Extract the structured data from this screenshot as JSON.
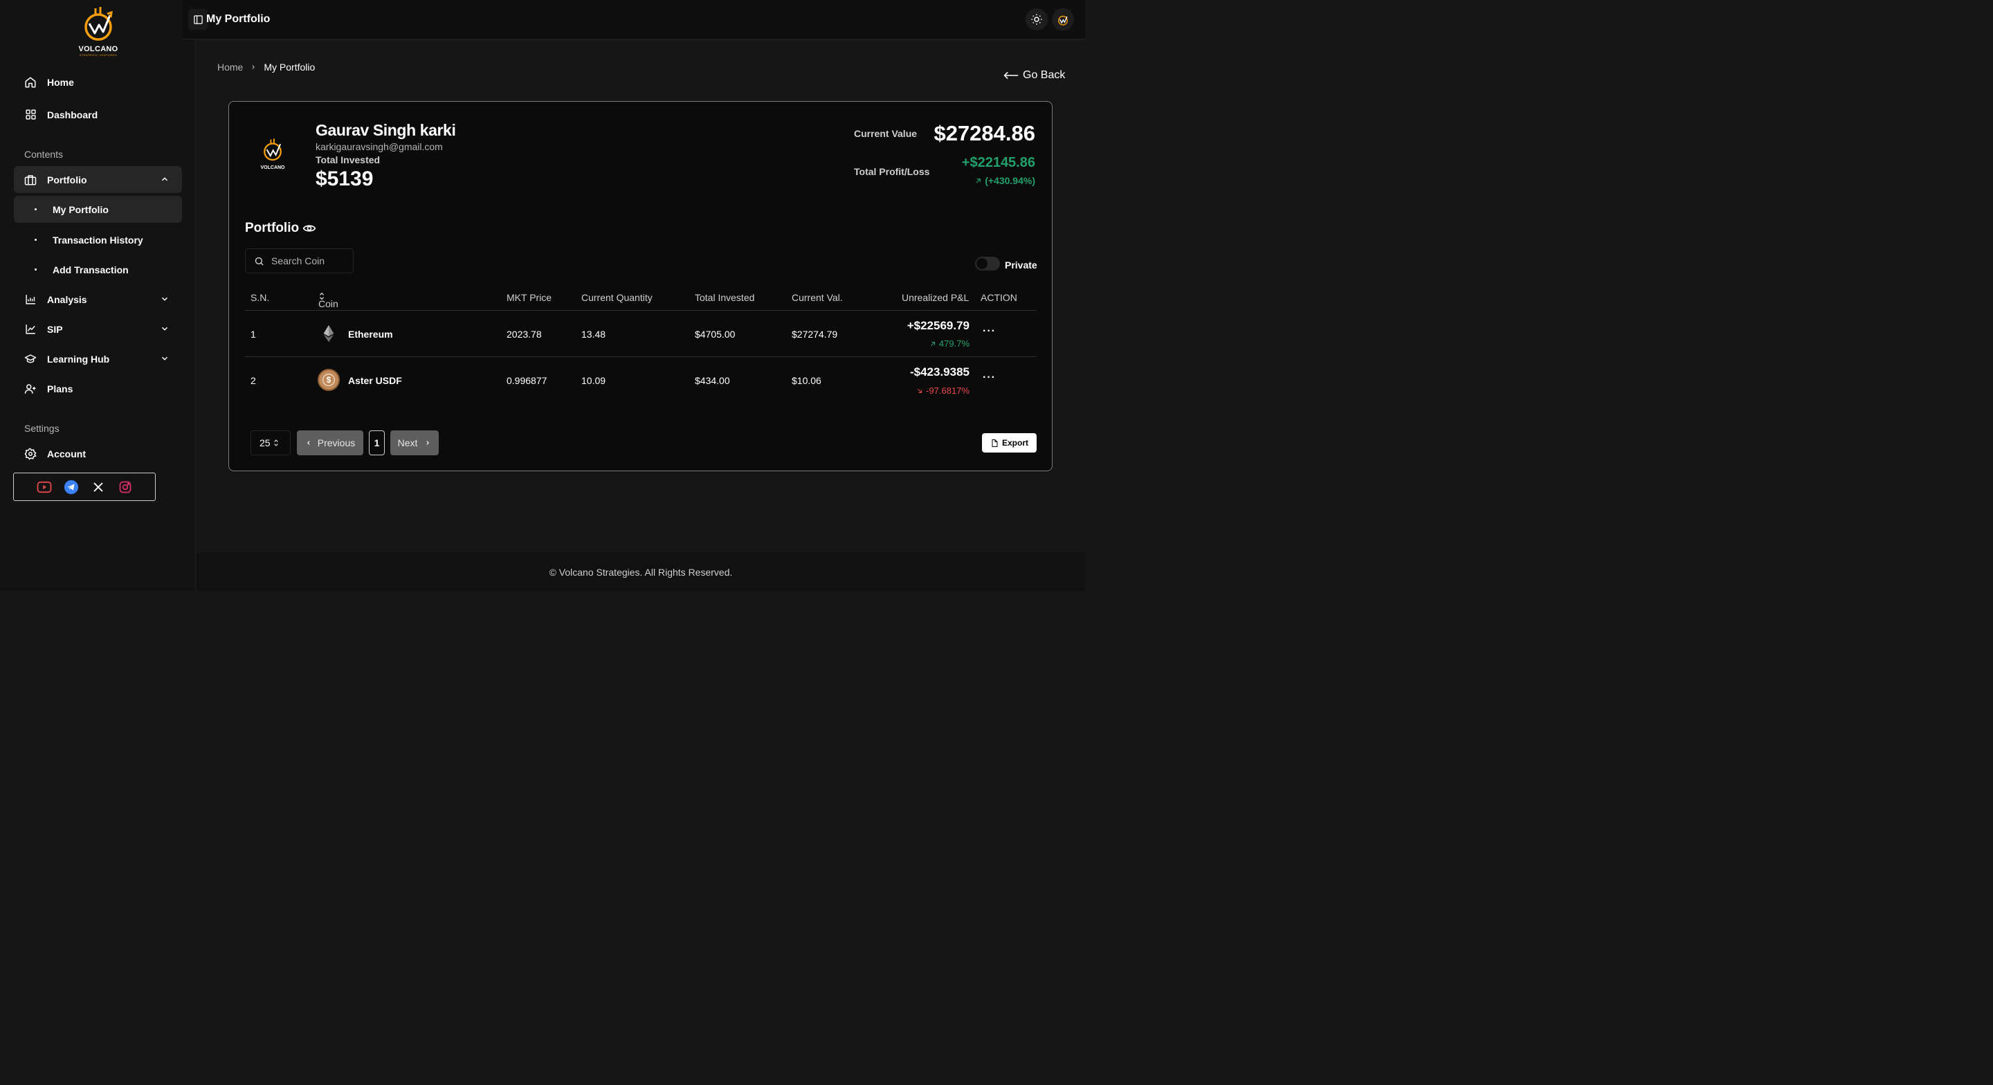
{
  "brand": {
    "name": "VOLCANO",
    "tagline": "STRATEGIC VENTURES",
    "accent": "#f59e0b"
  },
  "sidebar": {
    "main_items": [
      {
        "label": "Home",
        "icon": "home-icon"
      },
      {
        "label": "Dashboard",
        "icon": "grid-icon"
      }
    ],
    "contents_label": "Contents",
    "portfolio": {
      "label": "Portfolio",
      "icon": "briefcase-icon",
      "expanded": true,
      "children": [
        "My Portfolio",
        "Transaction History",
        "Add Transaction"
      ]
    },
    "groups": [
      {
        "label": "Analysis",
        "icon": "bar-chart-icon"
      },
      {
        "label": "SIP",
        "icon": "line-chart-icon"
      },
      {
        "label": "Learning Hub",
        "icon": "graduation-cap-icon"
      }
    ],
    "plans": {
      "label": "Plans",
      "icon": "user-plus-icon"
    },
    "settings_label": "Settings",
    "account": {
      "label": "Account",
      "icon": "gear-icon"
    },
    "socials": [
      "youtube-icon",
      "telegram-icon",
      "x-icon",
      "instagram-icon"
    ]
  },
  "topbar": {
    "title": "My Portfolio"
  },
  "breadcrumb": {
    "home": "Home",
    "current": "My Portfolio"
  },
  "go_back": "Go Back",
  "profile": {
    "name": "Gaurav Singh karki",
    "email": "karkigauravsingh@gmail.com",
    "total_invested_label": "Total Invested",
    "total_invested": "$5139",
    "current_value_label": "Current Value",
    "current_value": "$27284.86",
    "profit_loss_label": "Total Profit/Loss",
    "profit_loss": "+$22145.86",
    "profit_loss_pct": "(+430.94%)",
    "positive_color": "#22a06b",
    "negative_color": "#e5484d"
  },
  "portfolio": {
    "title": "Portfolio",
    "search_placeholder": "Search Coin",
    "private_label": "Private",
    "private_on": false,
    "columns": [
      "S.N.",
      "Coin",
      "MKT Price",
      "Current Quantity",
      "Total Invested",
      "Current Val.",
      "Unrealized P&L",
      "ACTION"
    ],
    "rows": [
      {
        "sn": "1",
        "coin": "Ethereum",
        "icon": "ethereum-icon",
        "price": "2023.78",
        "qty": "13.48",
        "invested": "$4705.00",
        "value": "$27274.79",
        "pnl": "+$22569.79",
        "pnl_pct": "479.7%",
        "direction": "up"
      },
      {
        "sn": "2",
        "coin": "Aster USDF",
        "icon": "dollar-coin-icon",
        "price": "0.996877",
        "qty": "10.09",
        "invested": "$434.00",
        "value": "$10.06",
        "pnl": "-$423.9385",
        "pnl_pct": "-97.6817%",
        "direction": "down"
      }
    ],
    "page_size": "25",
    "prev_label": "Previous",
    "current_page": "1",
    "next_label": "Next",
    "export_label": "Export"
  },
  "footer": "© Volcano Strategies. All Rights Reserved."
}
